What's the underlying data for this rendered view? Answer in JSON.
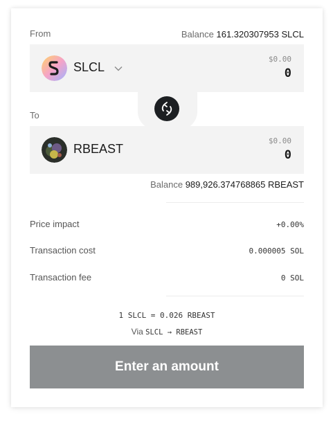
{
  "from": {
    "label": "From",
    "balance_label": "Balance",
    "balance_value": "161.320307953 SLCL",
    "token": "SLCL",
    "usd_value": "$0.00",
    "amount": "0",
    "icon": "slcl-token-icon"
  },
  "to": {
    "label": "To",
    "token": "RBEAST",
    "usd_value": "$0.00",
    "amount": "0",
    "balance_label": "Balance",
    "balance_value": "989,926.374768865 RBEAST",
    "icon": "rbeast-token-icon"
  },
  "details": [
    {
      "label": "Price impact",
      "value": "+0.00%"
    },
    {
      "label": "Transaction cost",
      "value": "0.000005 SOL"
    },
    {
      "label": "Transaction fee",
      "value": "0 SOL"
    }
  ],
  "rate": "1 SLCL = 0.026 RBEAST",
  "via": {
    "prefix": "Via",
    "route": "SLCL → RBEAST"
  },
  "cta": {
    "label": "Enter an amount"
  },
  "colors": {
    "cta_bg": "#8c8f91",
    "swap_bg": "#1c1f22",
    "box_bg": "#f3f3f3"
  }
}
